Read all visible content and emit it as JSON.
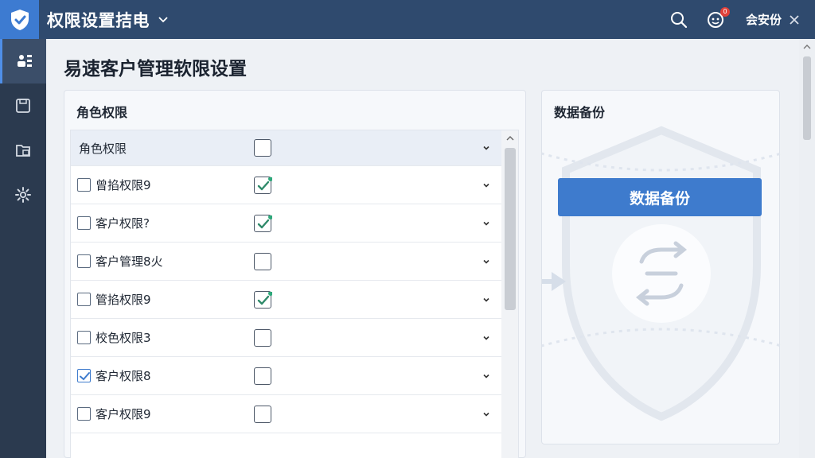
{
  "titlebar": {
    "title": "权限设置拮电",
    "notification_count": "0",
    "user_label": "会安份"
  },
  "sidebar": {
    "items": [
      {
        "icon": "users-icon",
        "active": true
      },
      {
        "icon": "save-icon",
        "active": false
      },
      {
        "icon": "folder-icon",
        "active": false
      },
      {
        "icon": "gear-icon",
        "active": false
      }
    ]
  },
  "page": {
    "title": "易速客户管理软限设置"
  },
  "roles_panel": {
    "title": "角色权限",
    "header_label": "角色权限",
    "rows": [
      {
        "name": "曾掐权限9",
        "left_checked": false,
        "right_checked": true
      },
      {
        "name": "客户权限?",
        "left_checked": false,
        "right_checked": true
      },
      {
        "name": "客户管理8火",
        "left_checked": false,
        "right_checked": false
      },
      {
        "name": "管掐权限9",
        "left_checked": false,
        "right_checked": true
      },
      {
        "name": "校色权限3",
        "left_checked": false,
        "right_checked": false
      },
      {
        "name": "客户权限8",
        "left_checked": true,
        "right_checked": false
      },
      {
        "name": "客户权限9",
        "left_checked": false,
        "right_checked": false
      }
    ]
  },
  "backup_panel": {
    "title": "数据备份",
    "button_label": "数据备份"
  },
  "colors": {
    "titlebar": "#2f4a6e",
    "accent": "#3e7bcd",
    "check_green": "#2ea87a",
    "sidebar": "#2b3a4f"
  }
}
